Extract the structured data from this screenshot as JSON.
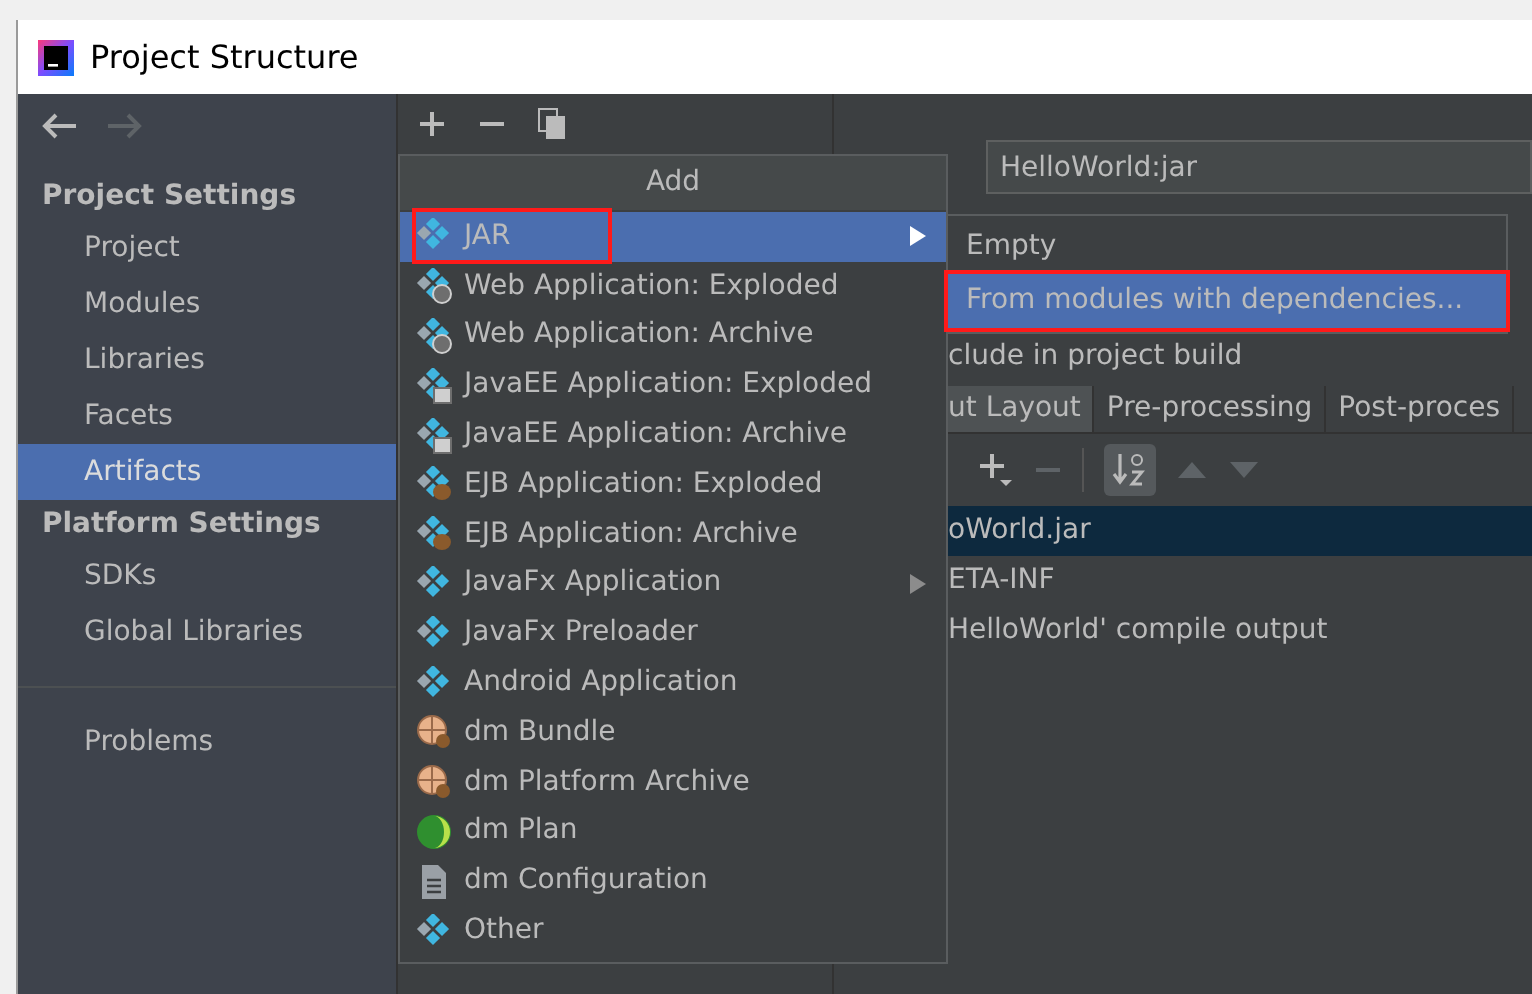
{
  "window": {
    "title": "Project Structure"
  },
  "sidebar": {
    "sections": [
      {
        "heading": "Project Settings",
        "items": [
          {
            "label": "Project",
            "selected": false
          },
          {
            "label": "Modules",
            "selected": false
          },
          {
            "label": "Libraries",
            "selected": false
          },
          {
            "label": "Facets",
            "selected": false
          },
          {
            "label": "Artifacts",
            "selected": true
          }
        ]
      },
      {
        "heading": "Platform Settings",
        "items": [
          {
            "label": "SDKs",
            "selected": false
          },
          {
            "label": "Global Libraries",
            "selected": false
          }
        ]
      },
      {
        "items": [
          {
            "label": "Problems",
            "selected": false
          }
        ]
      }
    ]
  },
  "artifact": {
    "name_value": "HelloWorld:jar",
    "include_label": "clude in project build",
    "tabs": [
      {
        "label": "ut Layout",
        "selected": true
      },
      {
        "label": "Pre-processing",
        "selected": false
      },
      {
        "label": "Post-proces",
        "selected": false
      }
    ],
    "sort_on": true,
    "tree": [
      {
        "label": "oWorld.jar",
        "selected": true
      },
      {
        "label": "ETA-INF",
        "selected": false
      },
      {
        "label": "HelloWorld' compile output",
        "selected": false
      }
    ]
  },
  "add_menu": {
    "title": "Add",
    "items": [
      {
        "label": "JAR",
        "kind": "plain",
        "submenu": true,
        "selected": true,
        "highlighted": true
      },
      {
        "label": "Web Application: Exploded",
        "kind": "web",
        "submenu": false,
        "selected": false,
        "highlighted": false
      },
      {
        "label": "Web Application: Archive",
        "kind": "web",
        "submenu": false,
        "selected": false,
        "highlighted": false
      },
      {
        "label": "JavaEE Application: Exploded",
        "kind": "javaee",
        "submenu": false,
        "selected": false,
        "highlighted": false
      },
      {
        "label": "JavaEE Application: Archive",
        "kind": "javaee",
        "submenu": false,
        "selected": false,
        "highlighted": false
      },
      {
        "label": "EJB Application: Exploded",
        "kind": "ejb",
        "submenu": false,
        "selected": false,
        "highlighted": false
      },
      {
        "label": "EJB Application: Archive",
        "kind": "ejb",
        "submenu": false,
        "selected": false,
        "highlighted": false
      },
      {
        "label": "JavaFx Application",
        "kind": "plain",
        "submenu": true,
        "selected": false,
        "highlighted": false
      },
      {
        "label": "JavaFx Preloader",
        "kind": "plain",
        "submenu": false,
        "selected": false,
        "highlighted": false
      },
      {
        "label": "Android Application",
        "kind": "plain",
        "submenu": false,
        "selected": false,
        "highlighted": false
      },
      {
        "label": "dm Bundle",
        "kind": "bundle",
        "submenu": false,
        "selected": false,
        "highlighted": false
      },
      {
        "label": "dm Platform Archive",
        "kind": "bundle",
        "submenu": false,
        "selected": false,
        "highlighted": false
      },
      {
        "label": "dm Plan",
        "kind": "plan",
        "submenu": false,
        "selected": false,
        "highlighted": false
      },
      {
        "label": "dm Configuration",
        "kind": "file",
        "submenu": false,
        "selected": false,
        "highlighted": false
      },
      {
        "label": "Other",
        "kind": "plain",
        "submenu": false,
        "selected": false,
        "highlighted": false
      }
    ]
  },
  "jar_submenu": {
    "items": [
      {
        "label": "Empty",
        "selected": false,
        "highlighted": false
      },
      {
        "label": "From modules with dependencies...",
        "selected": true,
        "highlighted": true
      }
    ]
  }
}
